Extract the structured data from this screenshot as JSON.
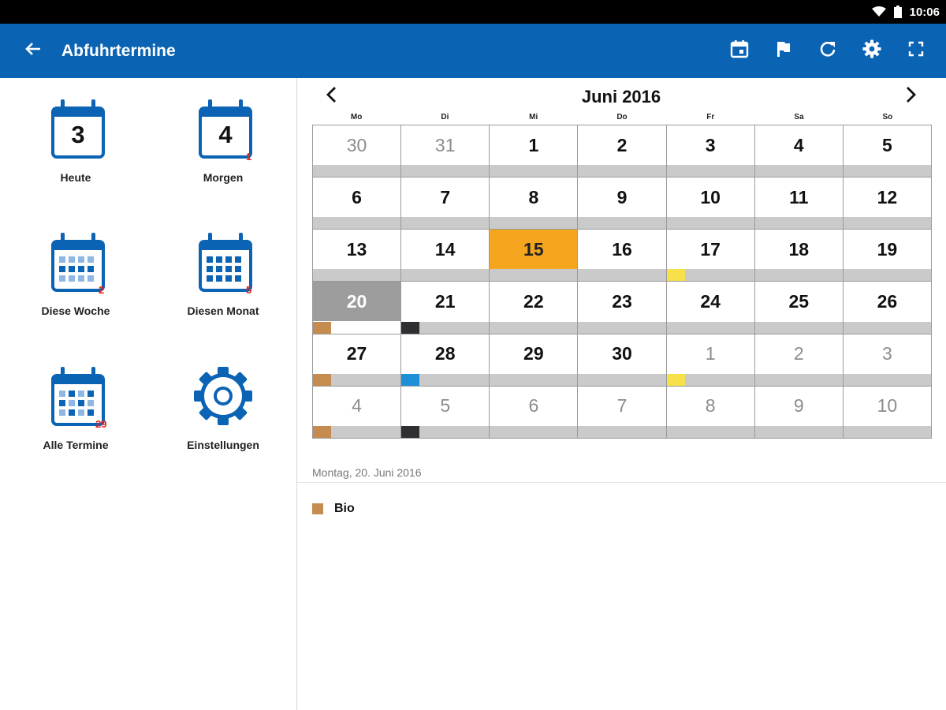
{
  "status_bar": {
    "time": "10:06",
    "icons": [
      "wifi-icon",
      "battery-icon"
    ]
  },
  "app_bar": {
    "title": "Abfuhrtermine",
    "back_icon": "arrow-left-icon",
    "actions": [
      "calendar-today-icon",
      "flag-icon",
      "refresh-icon",
      "settings-icon",
      "fullscreen-icon"
    ],
    "color": "#0b63b4"
  },
  "menu": [
    {
      "label": "Heute",
      "icon": "calendar-day-icon",
      "day": "3",
      "badge": ""
    },
    {
      "label": "Morgen",
      "icon": "calendar-day-icon",
      "day": "4",
      "badge": "1"
    },
    {
      "label": "Diese Woche",
      "icon": "calendar-week-icon",
      "day": "",
      "badge": "2"
    },
    {
      "label": "Diesen Monat",
      "icon": "calendar-month-icon",
      "day": "",
      "badge": "5"
    },
    {
      "label": "Alle Termine",
      "icon": "calendar-all-icon",
      "day": "",
      "badge": "29"
    },
    {
      "label": "Einstellungen",
      "icon": "gear-icon",
      "day": "",
      "badge": ""
    }
  ],
  "calendar": {
    "month_label": "Juni 2016",
    "prev_icon": "chevron-left-icon",
    "next_icon": "chevron-right-icon",
    "weekdays": [
      "Mo",
      "Di",
      "Mi",
      "Do",
      "Fr",
      "Sa",
      "So"
    ],
    "weeks": [
      [
        {
          "d": "30",
          "other": true
        },
        {
          "d": "31",
          "other": true
        },
        {
          "d": "1"
        },
        {
          "d": "2"
        },
        {
          "d": "3"
        },
        {
          "d": "4"
        },
        {
          "d": "5"
        }
      ],
      [
        {
          "d": "6"
        },
        {
          "d": "7"
        },
        {
          "d": "8"
        },
        {
          "d": "9"
        },
        {
          "d": "10"
        },
        {
          "d": "11"
        },
        {
          "d": "12"
        }
      ],
      [
        {
          "d": "13"
        },
        {
          "d": "14"
        },
        {
          "d": "15",
          "today": true
        },
        {
          "d": "16"
        },
        {
          "d": "17",
          "tag": "#f7e14a"
        },
        {
          "d": "18"
        },
        {
          "d": "19"
        }
      ],
      [
        {
          "d": "20",
          "selected": true,
          "tag": "#c68c4f"
        },
        {
          "d": "21",
          "tag": "#2f2f33"
        },
        {
          "d": "22"
        },
        {
          "d": "23"
        },
        {
          "d": "24"
        },
        {
          "d": "25"
        },
        {
          "d": "26"
        }
      ],
      [
        {
          "d": "27",
          "tag": "#c68c4f"
        },
        {
          "d": "28",
          "tag": "#1e90d8"
        },
        {
          "d": "29"
        },
        {
          "d": "30"
        },
        {
          "d": "1",
          "other": true,
          "tag": "#f7e14a"
        },
        {
          "d": "2",
          "other": true
        },
        {
          "d": "3",
          "other": true
        }
      ],
      [
        {
          "d": "4",
          "other": true,
          "tag": "#c68c4f"
        },
        {
          "d": "5",
          "other": true,
          "tag": "#2f2f33"
        },
        {
          "d": "6",
          "other": true
        },
        {
          "d": "7",
          "other": true
        },
        {
          "d": "8",
          "other": true
        },
        {
          "d": "9",
          "other": true
        },
        {
          "d": "10",
          "other": true
        }
      ]
    ]
  },
  "details": {
    "date": "Montag, 20. Juni 2016",
    "events": [
      {
        "label": "Bio",
        "color": "#c68c4f"
      }
    ]
  }
}
